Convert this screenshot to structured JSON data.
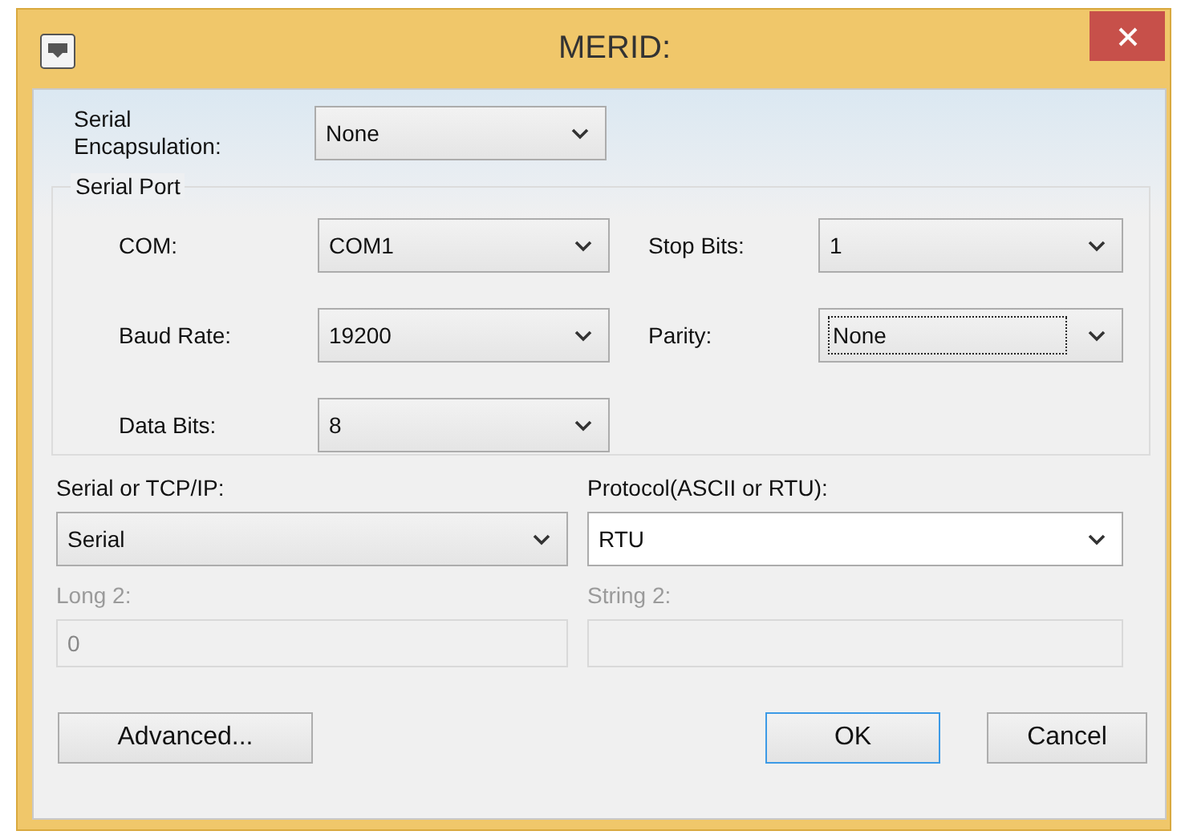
{
  "window": {
    "title": "MERID:"
  },
  "encapsulation": {
    "label": "Serial\nEncapsulation:",
    "value": "None",
    "kind": "dropdown",
    "focused": false
  },
  "serial_port": {
    "title": "Serial Port",
    "rows": [
      [
        {
          "label": "COM:",
          "value": "COM1",
          "kind": "dropdown",
          "focused": false
        },
        {
          "label": "Stop Bits:",
          "value": "1",
          "kind": "dropdown",
          "focused": false
        }
      ],
      [
        {
          "label": "Baud Rate:",
          "value": "19200",
          "kind": "dropdown",
          "focused": false
        },
        {
          "label": "Parity:",
          "value": "None",
          "kind": "dropdown",
          "focused": true
        }
      ],
      [
        {
          "label": "Data Bits:",
          "value": "8",
          "kind": "dropdown",
          "focused": false
        }
      ]
    ]
  },
  "settings": [
    {
      "label": "Serial or TCP/IP:",
      "value": "Serial",
      "kind": "dropdown",
      "disabled": false
    },
    {
      "label": "Protocol(ASCII or RTU):",
      "value": "RTU",
      "kind": "editable",
      "disabled": false
    },
    {
      "label": "Long 2:",
      "value": "0",
      "kind": "text",
      "disabled": true
    },
    {
      "label": "String 2:",
      "kind": "text",
      "disabled": true
    }
  ],
  "buttons": [
    {
      "label": "Advanced...",
      "default": false
    },
    {
      "label": "OK",
      "default": true
    },
    {
      "label": "Cancel",
      "default": false
    }
  ]
}
